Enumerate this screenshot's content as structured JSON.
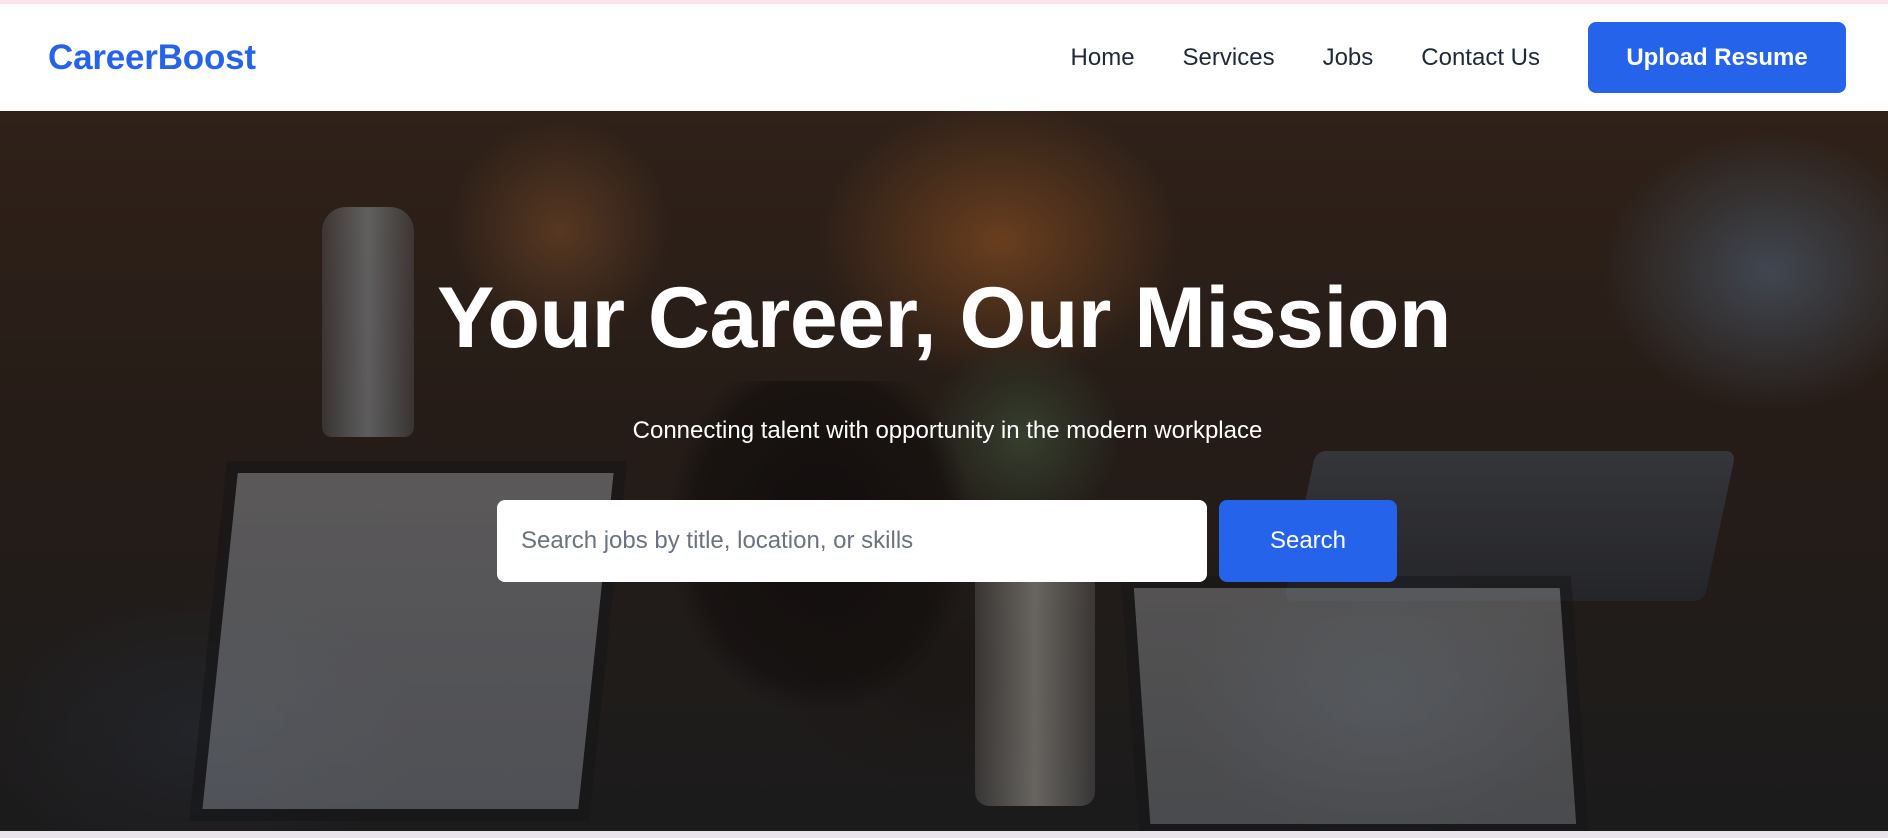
{
  "navbar": {
    "brand": "CareerBoost",
    "links": [
      {
        "label": "Home"
      },
      {
        "label": "Services"
      },
      {
        "label": "Jobs"
      },
      {
        "label": "Contact Us"
      }
    ],
    "upload_label": "Upload Resume"
  },
  "hero": {
    "title": "Your Career, Our Mission",
    "subtitle": "Connecting talent with opportunity in the modern workplace",
    "search": {
      "placeholder": "Search jobs by title, location, or skills",
      "value": "",
      "button_label": "Search"
    }
  },
  "colors": {
    "accent": "#2563eb",
    "nav_text": "#1f2937",
    "hero_text": "#ffffff"
  }
}
